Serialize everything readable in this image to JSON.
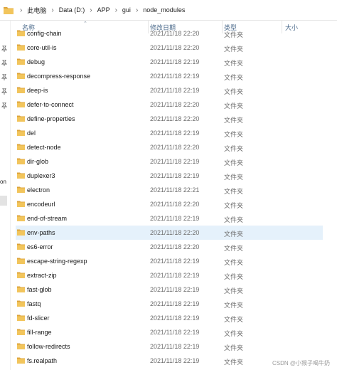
{
  "breadcrumb": [
    "此电脑",
    "Data (D:)",
    "APP",
    "gui",
    "node_modules"
  ],
  "columns": {
    "name": "名称",
    "date": "修改日期",
    "type": "类型",
    "size": "大小"
  },
  "left_cut_label": "on",
  "rows": [
    {
      "name": "config-chain",
      "date": "2021/11/18 22:20",
      "type": "文件夹",
      "selected": false
    },
    {
      "name": "core-util-is",
      "date": "2021/11/18 22:20",
      "type": "文件夹",
      "selected": false
    },
    {
      "name": "debug",
      "date": "2021/11/18 22:19",
      "type": "文件夹",
      "selected": false
    },
    {
      "name": "decompress-response",
      "date": "2021/11/18 22:19",
      "type": "文件夹",
      "selected": false
    },
    {
      "name": "deep-is",
      "date": "2021/11/18 22:19",
      "type": "文件夹",
      "selected": false
    },
    {
      "name": "defer-to-connect",
      "date": "2021/11/18 22:20",
      "type": "文件夹",
      "selected": false
    },
    {
      "name": "define-properties",
      "date": "2021/11/18 22:20",
      "type": "文件夹",
      "selected": false
    },
    {
      "name": "del",
      "date": "2021/11/18 22:19",
      "type": "文件夹",
      "selected": false
    },
    {
      "name": "detect-node",
      "date": "2021/11/18 22:20",
      "type": "文件夹",
      "selected": false
    },
    {
      "name": "dir-glob",
      "date": "2021/11/18 22:19",
      "type": "文件夹",
      "selected": false
    },
    {
      "name": "duplexer3",
      "date": "2021/11/18 22:19",
      "type": "文件夹",
      "selected": false
    },
    {
      "name": "electron",
      "date": "2021/11/18 22:21",
      "type": "文件夹",
      "selected": false
    },
    {
      "name": "encodeurl",
      "date": "2021/11/18 22:20",
      "type": "文件夹",
      "selected": false
    },
    {
      "name": "end-of-stream",
      "date": "2021/11/18 22:19",
      "type": "文件夹",
      "selected": false
    },
    {
      "name": "env-paths",
      "date": "2021/11/18 22:20",
      "type": "文件夹",
      "selected": true
    },
    {
      "name": "es6-error",
      "date": "2021/11/18 22:20",
      "type": "文件夹",
      "selected": false
    },
    {
      "name": "escape-string-regexp",
      "date": "2021/11/18 22:19",
      "type": "文件夹",
      "selected": false
    },
    {
      "name": "extract-zip",
      "date": "2021/11/18 22:19",
      "type": "文件夹",
      "selected": false
    },
    {
      "name": "fast-glob",
      "date": "2021/11/18 22:19",
      "type": "文件夹",
      "selected": false
    },
    {
      "name": "fastq",
      "date": "2021/11/18 22:19",
      "type": "文件夹",
      "selected": false
    },
    {
      "name": "fd-slicer",
      "date": "2021/11/18 22:19",
      "type": "文件夹",
      "selected": false
    },
    {
      "name": "fill-range",
      "date": "2021/11/18 22:19",
      "type": "文件夹",
      "selected": false
    },
    {
      "name": "follow-redirects",
      "date": "2021/11/18 22:19",
      "type": "文件夹",
      "selected": false
    },
    {
      "name": "fs.realpath",
      "date": "2021/11/18 22:19",
      "type": "文件夹",
      "selected": false
    }
  ],
  "watermark": "CSDN @小猴子喝牛奶",
  "colors": {
    "folder": "#f2c55c",
    "folder_dark": "#dca33a",
    "selection": "#e5f1fb",
    "header_text": "#4b6a8b"
  }
}
